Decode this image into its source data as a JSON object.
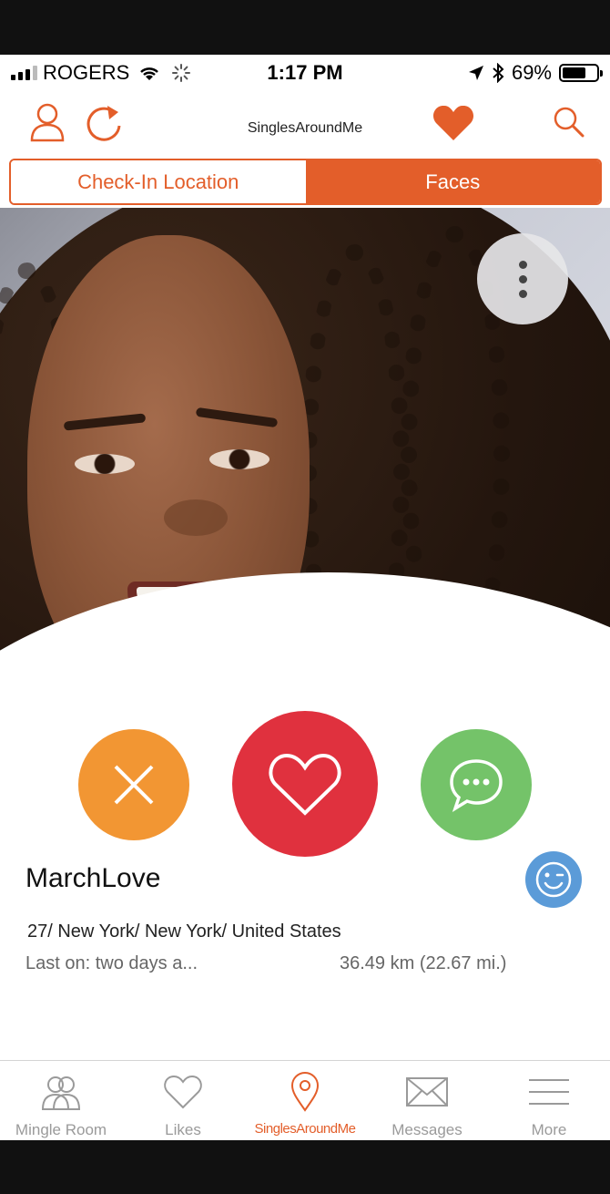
{
  "status_bar": {
    "carrier": "ROGERS",
    "time": "1:17 PM",
    "battery": "69%",
    "battery_level": 0.69,
    "signal_bars": 3
  },
  "nav": {
    "title": "SinglesAroundMe",
    "icons": [
      "profile-icon",
      "refresh-icon",
      "heart-icon",
      "search-icon"
    ]
  },
  "segment": {
    "left_label": "Check-In Location",
    "right_label": "Faces",
    "selected": "Faces"
  },
  "profile": {
    "username": "MarchLove",
    "location": "27/ New York/ New York/ United States",
    "last_on": "Last on: two days a...",
    "distance": "36.49 km (22.67 mi.)"
  },
  "tabs": [
    {
      "label": "Mingle Room",
      "icon": "people-icon"
    },
    {
      "label": "Likes",
      "icon": "heart-outline-icon"
    },
    {
      "label": "SinglesAroundMe",
      "icon": "location-pin-icon"
    },
    {
      "label": "Messages",
      "icon": "envelope-icon"
    },
    {
      "label": "More",
      "icon": "menu-lines-icon"
    }
  ],
  "colors": {
    "accent": "#e35e2a",
    "pass": "#f29633",
    "like": "#e0313e",
    "message": "#74c369",
    "wink": "#5b9bd8"
  }
}
